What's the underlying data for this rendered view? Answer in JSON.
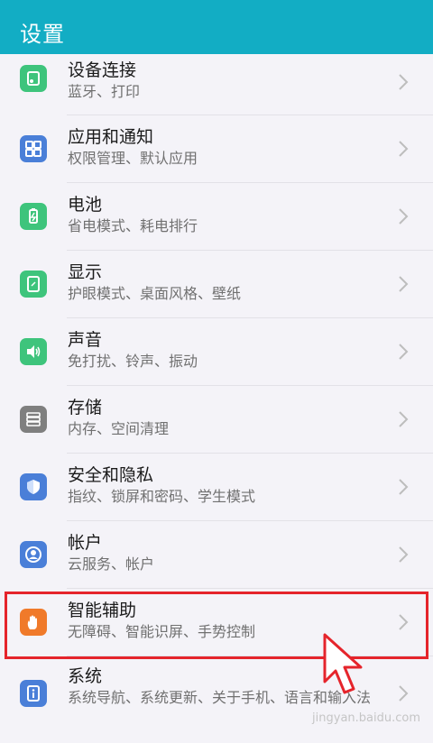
{
  "header": {
    "title": "设置"
  },
  "settings": [
    {
      "title": "设备连接",
      "subtitle": "蓝牙、打印",
      "icon": "device-connection-icon",
      "color": "#3ec47c"
    },
    {
      "title": "应用和通知",
      "subtitle": "权限管理、默认应用",
      "icon": "apps-grid-icon",
      "color": "#4a7fd8"
    },
    {
      "title": "电池",
      "subtitle": "省电模式、耗电排行",
      "icon": "battery-icon",
      "color": "#3ec47c"
    },
    {
      "title": "显示",
      "subtitle": "护眼模式、桌面风格、壁纸",
      "icon": "display-icon",
      "color": "#3ec47c"
    },
    {
      "title": "声音",
      "subtitle": "免打扰、铃声、振动",
      "icon": "speaker-icon",
      "color": "#3ec47c"
    },
    {
      "title": "存储",
      "subtitle": "内存、空间清理",
      "icon": "storage-icon",
      "color": "#7f7f7f"
    },
    {
      "title": "安全和隐私",
      "subtitle": "指纹、锁屏和密码、学生模式",
      "icon": "shield-icon",
      "color": "#4a7fd8"
    },
    {
      "title": "帐户",
      "subtitle": "云服务、帐户",
      "icon": "account-icon",
      "color": "#4a7fd8"
    },
    {
      "title": "智能辅助",
      "subtitle": "无障碍、智能识屏、手势控制",
      "icon": "hand-icon",
      "color": "#f07a2a"
    },
    {
      "title": "系统",
      "subtitle": "系统导航、系统更新、关于手机、语言和输入法",
      "icon": "info-icon",
      "color": "#4a7fd8"
    }
  ],
  "watermark": "jingyan.baidu.com",
  "colors": {
    "appbar": "#12adc4",
    "highlight": "#e5242b"
  }
}
